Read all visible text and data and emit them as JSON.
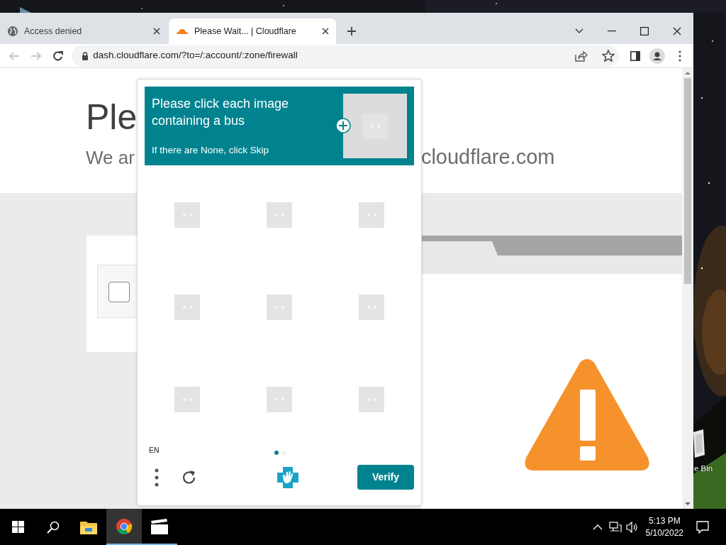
{
  "desktop": {
    "icons": [
      {
        "label": "e Bin"
      }
    ]
  },
  "browser": {
    "tabs": [
      {
        "title": "Access denied",
        "selected": false
      },
      {
        "title": "Please Wait... | Cloudflare",
        "selected": true
      }
    ],
    "address": "dash.cloudflare.com/?to=/:account/:zone/firewall",
    "back_disabled": true,
    "forward_disabled": true
  },
  "page": {
    "heading": "Ple",
    "subtitle_start": "We ar",
    "subtitle_end": "cloudflare.com",
    "checkbox": {
      "checked": false
    }
  },
  "captcha": {
    "prompt": "Please click each image containing a bus",
    "hint": "If there are None, click Skip",
    "tiles": [
      {
        "kind": "loading"
      },
      {
        "kind": "loading"
      },
      {
        "kind": "loading"
      },
      {
        "kind": "loading"
      },
      {
        "kind": "loading"
      },
      {
        "kind": "loading"
      },
      {
        "kind": "loading"
      },
      {
        "kind": "loading"
      },
      {
        "kind": "loading"
      }
    ],
    "language": "EN",
    "pages": [
      {
        "selected": true
      },
      {
        "selected": false
      }
    ],
    "verify_button": "Verify"
  },
  "taskbar": {
    "apps": [
      {
        "kind": "explorer",
        "active": false,
        "running": false
      },
      {
        "kind": "chrome",
        "active": true,
        "running": true
      },
      {
        "kind": "media",
        "active": false,
        "running": true
      }
    ],
    "time": "5:13 PM",
    "date": "5/10/2022"
  }
}
